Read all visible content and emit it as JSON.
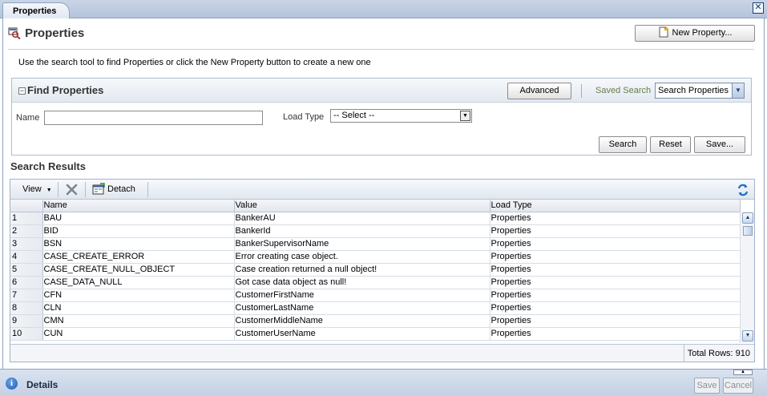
{
  "tab": {
    "label": "Properties",
    "close": "✕"
  },
  "header": {
    "title": "Properties",
    "new_property_label": "New Property..."
  },
  "instructions": "Use the search tool to find Properties or click the New Property button to create a new one",
  "find": {
    "title": "Find Properties",
    "advanced_label": "Advanced",
    "saved_search_label": "Saved Search",
    "saved_search_value": "Search Properties",
    "name_label": "Name",
    "name_value": "",
    "load_type_label": "Load Type",
    "load_type_value": "-- Select --",
    "search_label": "Search",
    "reset_label": "Reset",
    "save_label": "Save..."
  },
  "results": {
    "title": "Search Results",
    "view_label": "View",
    "detach_label": "Detach",
    "columns": [
      "",
      "Name",
      "Value",
      "Load Type"
    ],
    "rows": [
      [
        "1",
        "BAU",
        "BankerAU",
        "Properties"
      ],
      [
        "2",
        "BID",
        "BankerId",
        "Properties"
      ],
      [
        "3",
        "BSN",
        "BankerSupervisorName",
        "Properties"
      ],
      [
        "4",
        "CASE_CREATE_ERROR",
        "Error creating case object.",
        "Properties"
      ],
      [
        "5",
        "CASE_CREATE_NULL_OBJECT",
        "Case creation returned a null object!",
        "Properties"
      ],
      [
        "6",
        "CASE_DATA_NULL",
        "Got case data object as null!",
        "Properties"
      ],
      [
        "7",
        "CFN",
        "CustomerFirstName",
        "Properties"
      ],
      [
        "8",
        "CLN",
        "CustomerLastName",
        "Properties"
      ],
      [
        "9",
        "CMN",
        "CustomerMiddleName",
        "Properties"
      ],
      [
        "10",
        "CUN",
        "CustomerUserName",
        "Properties"
      ]
    ],
    "total_rows": "Total Rows: 910"
  },
  "bottom": {
    "details_label": "Details",
    "save_label": "Save",
    "cancel_label": "Cancel"
  },
  "colors": {
    "accent": "#1e59b4",
    "frame": "#8da2c0"
  }
}
